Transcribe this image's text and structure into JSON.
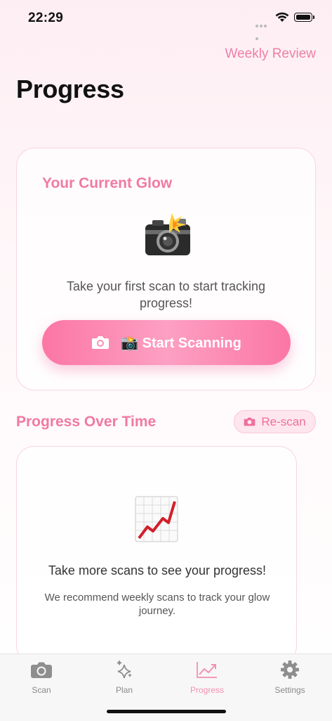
{
  "status_bar": {
    "time": "22:29"
  },
  "header": {
    "weekly_review": "Weekly Review",
    "title": "Progress"
  },
  "glow_card": {
    "title": "Your Current Glow",
    "icon": "camera-flash-icon",
    "message": "Take your first scan to start tracking progress!",
    "button_label": "📸 Start Scanning"
  },
  "progress_section": {
    "title": "Progress Over Time",
    "rescan_label": "Re-scan",
    "icon": "chart-increasing-icon",
    "message": "Take more scans to see your progress!",
    "sub_message": "We recommend weekly scans to track your glow journey."
  },
  "tabs": [
    {
      "label": "Scan",
      "icon": "camera-icon"
    },
    {
      "label": "Plan",
      "icon": "sparkles-icon"
    },
    {
      "label": "Progress",
      "icon": "chart-line-icon",
      "active": true
    },
    {
      "label": "Settings",
      "icon": "gear-icon"
    }
  ],
  "colors": {
    "accent": "#f07aa3",
    "tab_inactive": "#8a8a8a",
    "tab_active": "#f290b2"
  }
}
